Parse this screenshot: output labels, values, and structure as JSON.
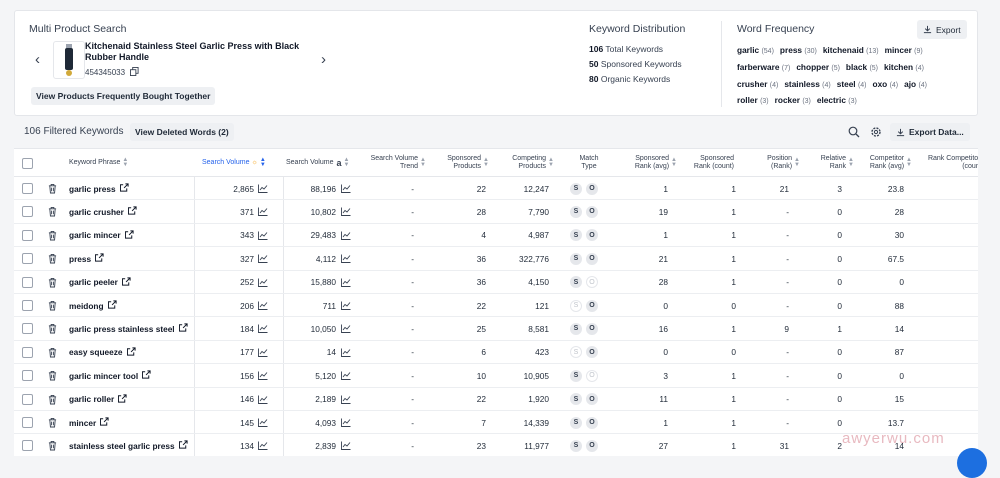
{
  "product_search": {
    "title": "Multi Product Search",
    "product_title": "Kitchenaid Stainless Steel Garlic Press with Black Rubber Handle",
    "asin": "454345033",
    "bought_together_label": "View Products Frequently Bought Together"
  },
  "keyword_distribution": {
    "title": "Keyword Distribution",
    "rows": [
      {
        "count": "106",
        "label": "Total Keywords"
      },
      {
        "count": "50",
        "label": "Sponsored Keywords"
      },
      {
        "count": "80",
        "label": "Organic Keywords"
      }
    ]
  },
  "word_frequency": {
    "title": "Word Frequency",
    "export_label": "Export",
    "words": [
      {
        "word": "garlic",
        "count": "(54)"
      },
      {
        "word": "press",
        "count": "(30)"
      },
      {
        "word": "kitchenaid",
        "count": "(13)"
      },
      {
        "word": "mincer",
        "count": "(9)"
      },
      {
        "word": "farberware",
        "count": "(7)"
      },
      {
        "word": "chopper",
        "count": "(5)"
      },
      {
        "word": "black",
        "count": "(5)"
      },
      {
        "word": "kitchen",
        "count": "(4)"
      },
      {
        "word": "crusher",
        "count": "(4)"
      },
      {
        "word": "stainless",
        "count": "(4)"
      },
      {
        "word": "steel",
        "count": "(4)"
      },
      {
        "word": "oxo",
        "count": "(4)"
      },
      {
        "word": "ajo",
        "count": "(4)"
      },
      {
        "word": "roller",
        "count": "(3)"
      },
      {
        "word": "rocker",
        "count": "(3)"
      },
      {
        "word": "electric",
        "count": "(3)"
      }
    ]
  },
  "toolbar": {
    "filtered_label": "106 Filtered Keywords",
    "deleted_label": "View Deleted Words (2)",
    "export_data_label": "Export Data..."
  },
  "table": {
    "headers": {
      "keyword": "Keyword Phrase",
      "sv": "Search Volume",
      "sv_amazon": "Search Volume",
      "sv_trend": "Search Volume Trend",
      "sp": "Sponsored Products",
      "cp": "Competing Products",
      "mt": "Match Type",
      "sr": "Sponsored Rank (avg)",
      "src": "Sponsored Rank (count)",
      "pos": "Position (Rank)",
      "rel": "Relative Rank",
      "comp": "Competitor Rank (avg)",
      "rc": "Rank Competitors (count)"
    },
    "rows": [
      {
        "kw": "garlic press",
        "sv": "2,865",
        "sva": "88,196",
        "trend": "-",
        "sp": "22",
        "cp": "12,247",
        "s": true,
        "o": true,
        "sr": "1",
        "src": "1",
        "pos": "21",
        "rel": "3",
        "comp": "23.8"
      },
      {
        "kw": "garlic crusher",
        "sv": "371",
        "sva": "10,802",
        "trend": "-",
        "sp": "28",
        "cp": "7,790",
        "s": true,
        "o": true,
        "sr": "19",
        "src": "1",
        "pos": "-",
        "rel": "0",
        "comp": "28"
      },
      {
        "kw": "garlic mincer",
        "sv": "343",
        "sva": "29,483",
        "trend": "-",
        "sp": "4",
        "cp": "4,987",
        "s": true,
        "o": true,
        "sr": "1",
        "src": "1",
        "pos": "-",
        "rel": "0",
        "comp": "30"
      },
      {
        "kw": "press",
        "sv": "327",
        "sva": "4,112",
        "trend": "-",
        "sp": "36",
        "cp": "322,776",
        "s": true,
        "o": true,
        "sr": "21",
        "src": "1",
        "pos": "-",
        "rel": "0",
        "comp": "67.5"
      },
      {
        "kw": "garlic peeler",
        "sv": "252",
        "sva": "15,880",
        "trend": "-",
        "sp": "36",
        "cp": "4,150",
        "s": true,
        "o": false,
        "sr": "28",
        "src": "1",
        "pos": "-",
        "rel": "0",
        "comp": "0"
      },
      {
        "kw": "meidong",
        "sv": "206",
        "sva": "711",
        "trend": "-",
        "sp": "22",
        "cp": "121",
        "s": false,
        "o": true,
        "sr": "0",
        "src": "0",
        "pos": "-",
        "rel": "0",
        "comp": "88"
      },
      {
        "kw": "garlic press stainless steel",
        "sv": "184",
        "sva": "10,050",
        "trend": "-",
        "sp": "25",
        "cp": "8,581",
        "s": true,
        "o": true,
        "sr": "16",
        "src": "1",
        "pos": "9",
        "rel": "1",
        "comp": "14"
      },
      {
        "kw": "easy squeeze",
        "sv": "177",
        "sva": "14",
        "trend": "-",
        "sp": "6",
        "cp": "423",
        "s": false,
        "o": true,
        "sr": "0",
        "src": "0",
        "pos": "-",
        "rel": "0",
        "comp": "87"
      },
      {
        "kw": "garlic mincer tool",
        "sv": "156",
        "sva": "5,120",
        "trend": "-",
        "sp": "10",
        "cp": "10,905",
        "s": true,
        "o": false,
        "sr": "3",
        "src": "1",
        "pos": "-",
        "rel": "0",
        "comp": "0"
      },
      {
        "kw": "garlic roller",
        "sv": "146",
        "sva": "2,189",
        "trend": "-",
        "sp": "22",
        "cp": "1,920",
        "s": true,
        "o": true,
        "sr": "11",
        "src": "1",
        "pos": "-",
        "rel": "0",
        "comp": "15"
      },
      {
        "kw": "mincer",
        "sv": "145",
        "sva": "4,093",
        "trend": "-",
        "sp": "7",
        "cp": "14,339",
        "s": true,
        "o": true,
        "sr": "1",
        "src": "1",
        "pos": "-",
        "rel": "0",
        "comp": "13.7"
      },
      {
        "kw": "stainless steel garlic press",
        "sv": "134",
        "sva": "2,839",
        "trend": "-",
        "sp": "23",
        "cp": "11,977",
        "s": true,
        "o": true,
        "sr": "27",
        "src": "1",
        "pos": "31",
        "rel": "2",
        "comp": "14"
      }
    ]
  },
  "watermark": "awyerwu.com"
}
